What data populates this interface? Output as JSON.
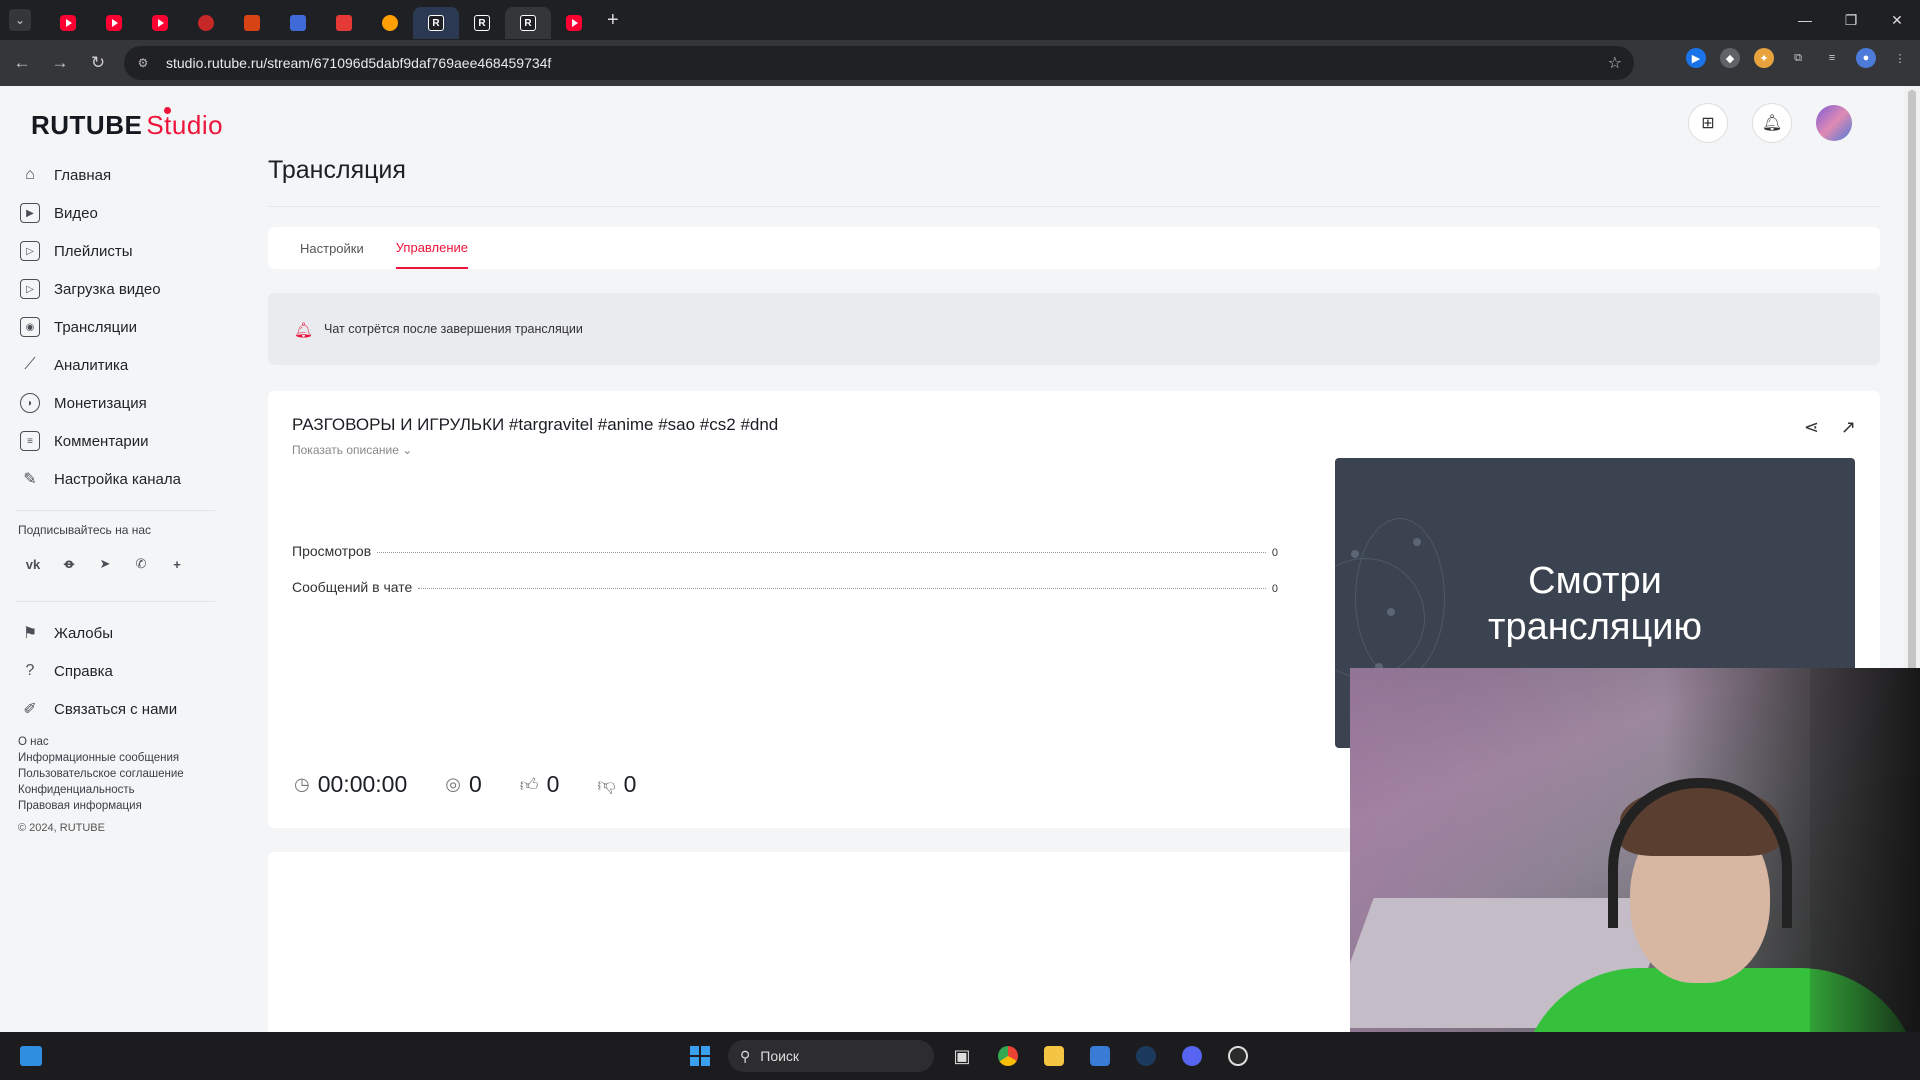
{
  "browser": {
    "url": "studio.rutube.ru/stream/671096d5dabf9daf769aee468459734f",
    "tabs": [
      {
        "favicon": "youtube-icon"
      },
      {
        "favicon": "youtube-icon"
      },
      {
        "favicon": "youtube-icon"
      },
      {
        "favicon": "red-globe-icon"
      },
      {
        "favicon": "cube-icon"
      },
      {
        "favicon": "blue-app-icon"
      },
      {
        "favicon": "ops-icon"
      },
      {
        "favicon": "fire-icon"
      },
      {
        "favicon": "rutube-icon",
        "label": "R"
      },
      {
        "favicon": "rutube-icon",
        "label": "R"
      },
      {
        "favicon": "rutube-icon",
        "label": "R",
        "active": true
      },
      {
        "favicon": "youtube-icon"
      }
    ]
  },
  "header": {
    "logo_main": "RUTUBE",
    "logo_studio": "Studio"
  },
  "sidebar": {
    "items": [
      {
        "label": "Главная",
        "icon": "home-icon"
      },
      {
        "label": "Видео",
        "icon": "video-icon"
      },
      {
        "label": "Плейлисты",
        "icon": "playlist-icon"
      },
      {
        "label": "Загрузка видео",
        "icon": "upload-icon"
      },
      {
        "label": "Трансляции",
        "icon": "broadcast-icon"
      },
      {
        "label": "Аналитика",
        "icon": "analytics-icon"
      },
      {
        "label": "Монетизация",
        "icon": "monetization-icon"
      },
      {
        "label": "Комментарии",
        "icon": "comments-icon"
      },
      {
        "label": "Настройка канала",
        "icon": "wand-icon"
      }
    ],
    "follow_label": "Подписывайтесь на нас",
    "socials": [
      "vk-icon",
      "ok-icon",
      "telegram-icon",
      "viber-icon",
      "plus-icon"
    ],
    "secondary": [
      {
        "label": "Жалобы",
        "icon": "flag-icon"
      },
      {
        "label": "Справка",
        "icon": "help-icon"
      },
      {
        "label": "Связаться с нами",
        "icon": "pen-icon"
      }
    ],
    "footer_links": [
      "О нас",
      "Информационные сообщения",
      "Пользовательское соглашение",
      "Конфиденциальность",
      "Правовая информация"
    ],
    "copyright": "© 2024, RUTUBE"
  },
  "main": {
    "page_title": "Трансляция",
    "tabs": [
      {
        "label": "Настройки",
        "active": false
      },
      {
        "label": "Управление",
        "active": true
      }
    ],
    "notice": "Чат сотрётся после завершения трансляции",
    "stream": {
      "title": "РАЗГОВОРЫ И ИГРУЛЬКИ #targravitel #anime #sao #cs2 #dnd",
      "show_description": "Показать описание",
      "stats": [
        {
          "label": "Просмотров",
          "value": "0"
        },
        {
          "label": "Сообщений в чате",
          "value": "0"
        }
      ],
      "duration": "00:00:00",
      "viewers": "0",
      "likes": "0",
      "dislikes": "0",
      "preview_text_line1": "Смотри",
      "preview_text_line2": "трансляцию"
    }
  },
  "taskbar": {
    "search_placeholder": "Поиск"
  },
  "colors": {
    "accent": "#ed143b",
    "sidebar_text": "#1f2329",
    "preview_bg": "#3b4350",
    "webcam_shirt": "#36c13c"
  }
}
